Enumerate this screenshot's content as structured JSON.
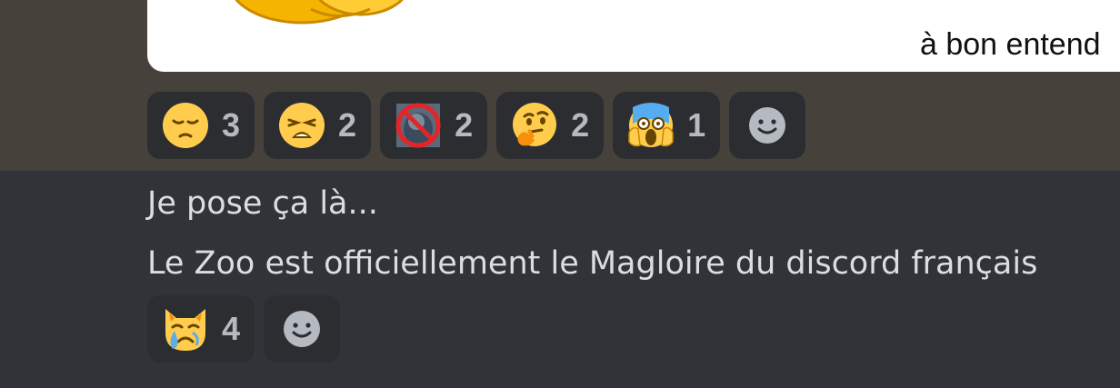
{
  "embed": {
    "caption": "à bon entend"
  },
  "reactions_1": [
    {
      "icon": "pensive-face-icon",
      "count": "3"
    },
    {
      "icon": "weary-face-icon",
      "count": "2"
    },
    {
      "icon": "custom-prohibited-emoji-icon",
      "count": "2"
    },
    {
      "icon": "thinking-face-icon",
      "count": "2"
    },
    {
      "icon": "screaming-face-icon",
      "count": "1"
    }
  ],
  "messages": [
    {
      "text": "Je pose ça là..."
    },
    {
      "text": "Le Zoo est officiellement le Magloire du discord français"
    }
  ],
  "reactions_2": [
    {
      "icon": "crying-cat-face-icon",
      "count": "4"
    }
  ],
  "colors": {
    "top_background": "#46423b",
    "chat_background": "#323339",
    "reaction_pill": "#2b2d31",
    "count_text": "#b5bac1",
    "message_text": "#dbdee1",
    "emoji_yellow": "#ffcc4d"
  }
}
